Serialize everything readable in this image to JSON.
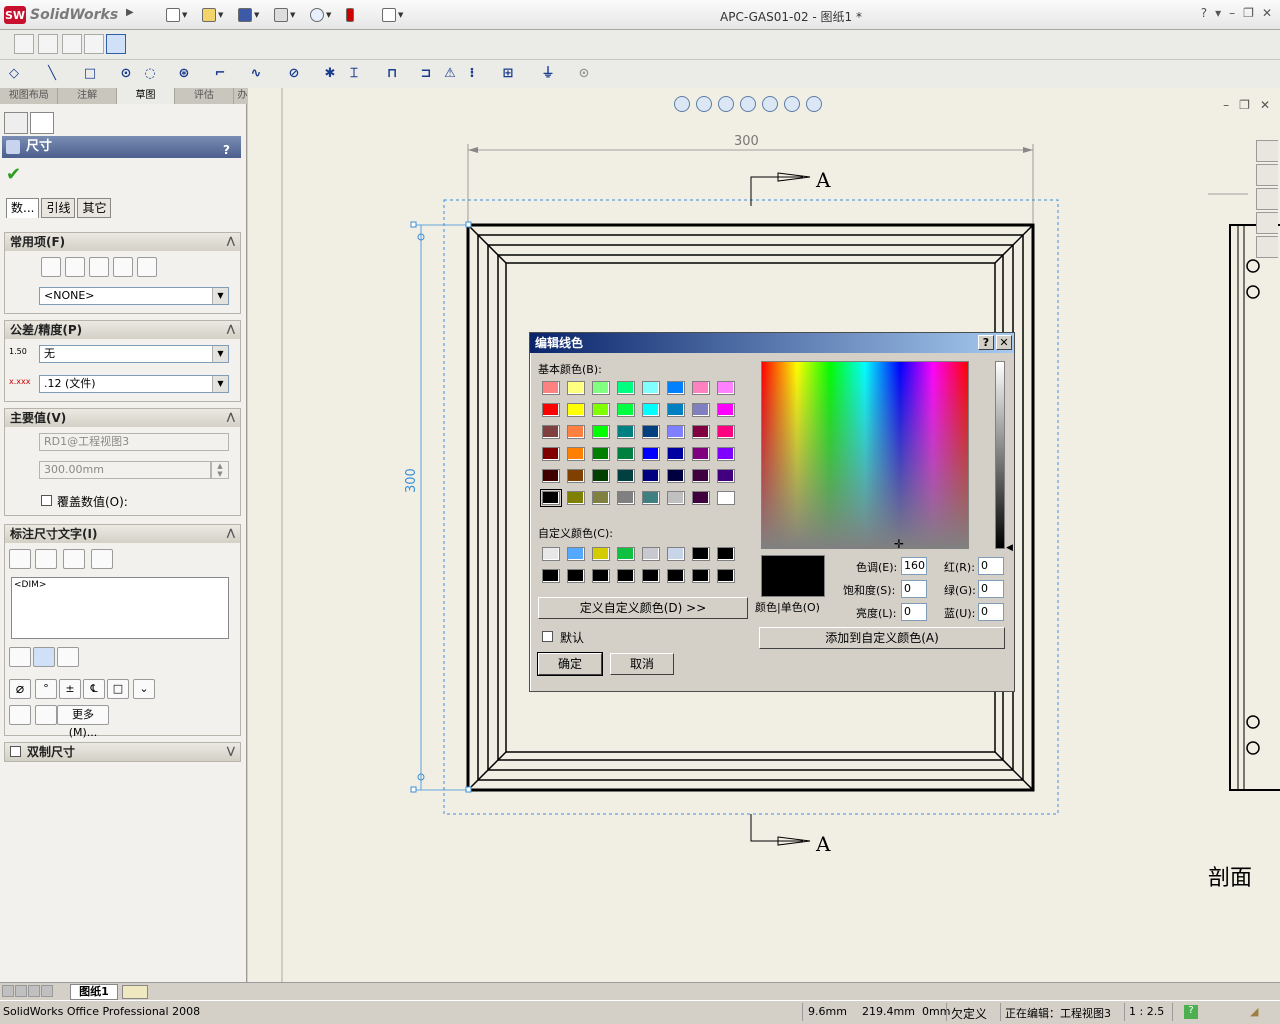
{
  "app": {
    "name": "SolidWorks",
    "document_title": "APC-GAS01-02 - 图纸1 *"
  },
  "window": {
    "help": "?",
    "minimize": "–",
    "restore": "❐",
    "close": "✕"
  },
  "command_tabs": [
    "视图布局",
    "注解",
    "草图",
    "评估",
    "办公室产品"
  ],
  "property_manager": {
    "title": "尺寸",
    "help": "?",
    "ok": "✔",
    "tabs": [
      "数...",
      "引线",
      "其它"
    ],
    "groups": {
      "favorites": {
        "title": "常用项(F)",
        "style_value": "<NONE>"
      },
      "tolerance": {
        "title": "公差/精度(P)",
        "tolerance_value": "无",
        "precision_value": ".12 (文件)",
        "tol_label": "1.50",
        "prec_label": "x.xxx"
      },
      "primary_value": {
        "title": "主要值(V)",
        "name_value": "RD1@工程视图3",
        "value": "300.00mm",
        "override_label": "覆盖数值(O):"
      },
      "dim_text": {
        "title": "标注尺寸文字(I)",
        "text": "<DIM>",
        "more_label": "更多(M)..."
      },
      "dual_dim": {
        "title": "双制尺寸"
      }
    }
  },
  "drawing": {
    "dim_top": "300",
    "dim_left": "300",
    "section_label_a": "A",
    "section_title": "剖面"
  },
  "dialog": {
    "title": "编辑线色",
    "help": "?",
    "close": "✕",
    "basic_colors_label": "基本颜色(B):",
    "custom_colors_label": "自定义颜色(C):",
    "define_custom_button": "定义自定义颜色(D) >>",
    "default_label": "默认",
    "ok_button": "确定",
    "cancel_button": "取消",
    "color_solid_label": "颜色|单色(O)",
    "add_custom_button": "添加到自定义颜色(A)",
    "hue_label": "色调(E):",
    "hue_value": "160",
    "sat_label": "饱和度(S):",
    "sat_value": "0",
    "lum_label": "亮度(L):",
    "lum_value": "0",
    "red_label": "红(R):",
    "red_value": "0",
    "green_label": "绿(G):",
    "green_value": "0",
    "blue_label": "蓝(U):",
    "blue_value": "0",
    "basic_colors": [
      "#ff8080",
      "#ffff80",
      "#80ff80",
      "#00ff80",
      "#80ffff",
      "#0080ff",
      "#ff80c0",
      "#ff80ff",
      "#ff0000",
      "#ffff00",
      "#80ff00",
      "#00ff40",
      "#00ffff",
      "#0080c0",
      "#8080c0",
      "#ff00ff",
      "#804040",
      "#ff8040",
      "#00ff00",
      "#008080",
      "#004080",
      "#8080ff",
      "#800040",
      "#ff0080",
      "#800000",
      "#ff8000",
      "#008000",
      "#008040",
      "#0000ff",
      "#0000a0",
      "#800080",
      "#8000ff",
      "#400000",
      "#804000",
      "#004000",
      "#004040",
      "#000080",
      "#000040",
      "#400040",
      "#400080",
      "#000000",
      "#808000",
      "#808040",
      "#808080",
      "#408080",
      "#c0c0c0",
      "#400040",
      "#ffffff"
    ],
    "custom_colors": [
      "#e8e8e8",
      "#55a8ff",
      "#d4cc00",
      "#10c040",
      "#c8c8d0",
      "#c8d4e8",
      "#000000",
      "#000000",
      "#000000",
      "#000000",
      "#000000",
      "#000000",
      "#000000",
      "#000000",
      "#000000",
      "#000000"
    ]
  },
  "sheet_tab": "图纸1",
  "status": {
    "product": "SolidWorks Office Professional 2008",
    "x": "9.6mm",
    "y": "219.4mm",
    "z": "0mm",
    "state": "欠定义",
    "editing": "正在编辑：工程视图3",
    "scale": "1 : 2.5"
  }
}
